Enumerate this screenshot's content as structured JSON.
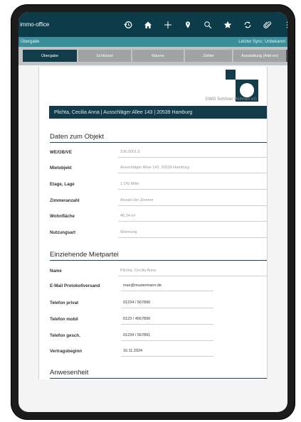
{
  "app": {
    "title": "immo-office"
  },
  "subbar": {
    "left": "Übergabe",
    "right": "Letzter Sync: Unbekannt"
  },
  "toolbar": {
    "icons": [
      "history-icon",
      "home-icon",
      "plus-icon",
      "location-pin-icon",
      "search-icon",
      "star-icon",
      "sync-icon",
      "attachment-icon",
      "more-vertical-icon"
    ]
  },
  "tabs": [
    "Übergabe",
    "Schlüssel",
    "Räume",
    "Zähler",
    "Ausstattung (Add-on)"
  ],
  "document": {
    "company": "GWG Schöner Wohnen eG",
    "tenant_banner": "Plichta, Cecilia Anna | Ausschläger Allee 143 | 20539 Hamburg"
  },
  "objekt": {
    "title": "Daten zum Objekt",
    "rows": [
      {
        "label": "WE/OB/VE",
        "value": "106.0001.5"
      },
      {
        "label": "Mietobjekt",
        "value": "Ausschläger Allee 143, 20539 Hamburg"
      },
      {
        "label": "Etage, Lage",
        "value": "1.OG Mitte"
      },
      {
        "label": "Zimmeranzahl",
        "value": "Anzahl der Zimmer"
      },
      {
        "label": "Wohnfläche",
        "value": "46,34 m²"
      },
      {
        "label": "Nutzungsart",
        "value": "Wohnung"
      }
    ]
  },
  "mieter": {
    "title": "Einziehende Mietpartei",
    "rows": [
      {
        "label": "Name",
        "value": "Plichta, Cecilia Anna"
      },
      {
        "label": "E-Mail Protokollversand",
        "value": "max@mustermann.de"
      },
      {
        "label": "Telefon privat",
        "value": "01234 / 567890"
      },
      {
        "label": "Telefon mobil",
        "value": "0123 / 4567890"
      },
      {
        "label": "Telefon gesch.",
        "value": "01234 / 567891"
      },
      {
        "label": "Vertragsbeginn",
        "value": "16.11.2024"
      }
    ]
  },
  "anwesenheit": {
    "title": "Anwesenheit"
  },
  "colors": {
    "appbar": "#0c3b49",
    "subbar": "#3a8f9b",
    "accent": "#123c4a"
  }
}
